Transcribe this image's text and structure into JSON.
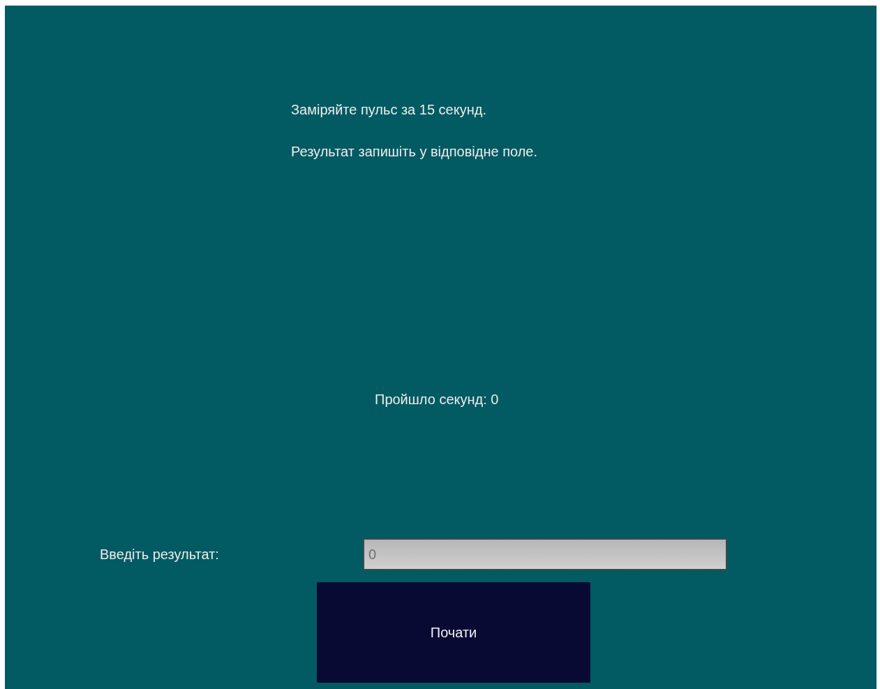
{
  "instructions": [
    "Заміряйте пульс за 15 секунд.",
    "Результат запишіть у відповідне поле."
  ],
  "timer": "Пройшло секунд: 0",
  "result": {
    "label": "Введіть результат:",
    "placeholder": "0"
  },
  "button": "Почати"
}
